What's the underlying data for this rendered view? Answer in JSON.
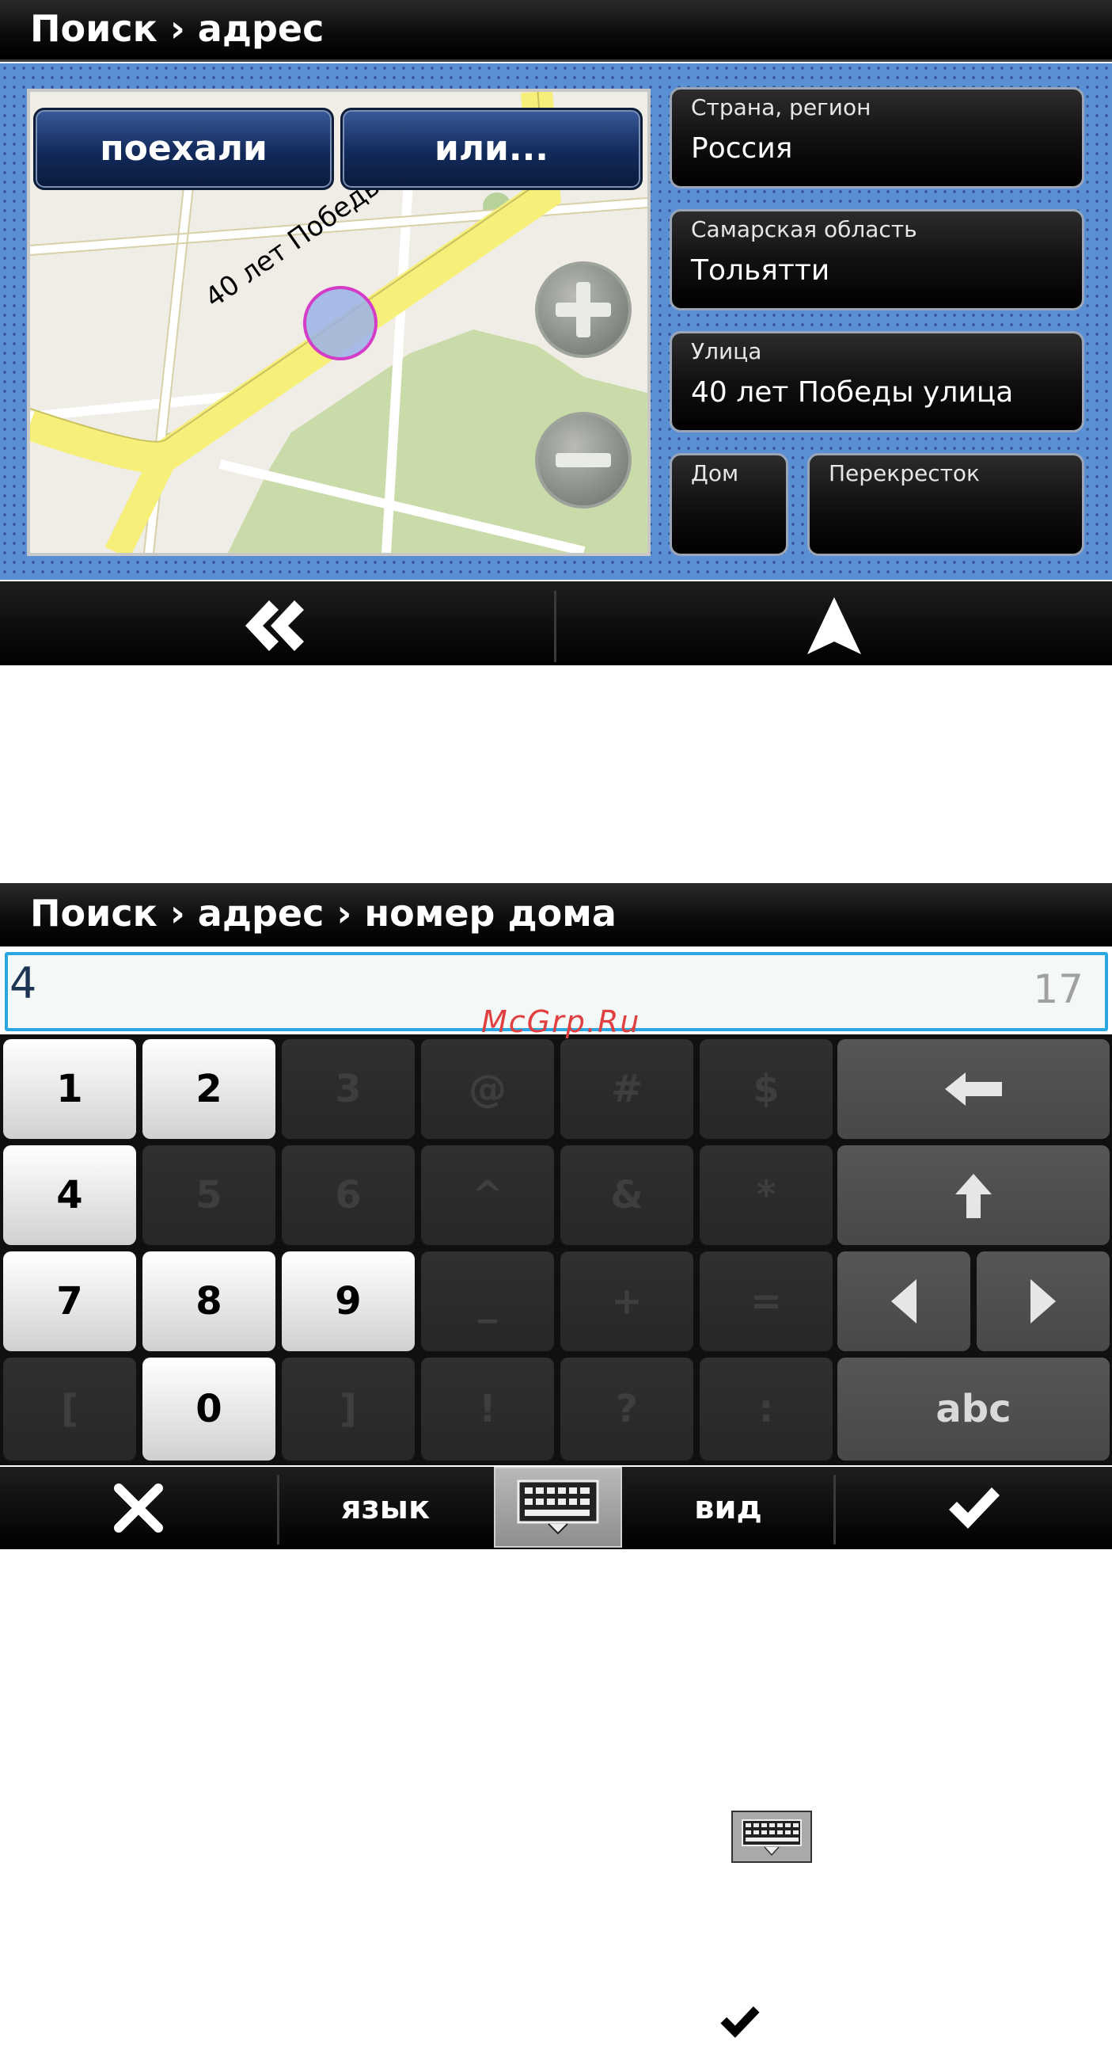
{
  "screen1": {
    "title": "Поиск › адрес",
    "map": {
      "go_button": "поехали",
      "or_button": "или...",
      "street_label": "40 лет Победы улица"
    },
    "fields": {
      "country": {
        "label": "Страна, регион",
        "value": "Россия"
      },
      "region": {
        "label": "Самарская область",
        "value": "Тольятти"
      },
      "street": {
        "label": "Улица",
        "value": "40 лет Победы улица"
      },
      "house": {
        "label": "Дом",
        "value": ""
      },
      "crossing": {
        "label": "Перекресток",
        "value": ""
      }
    },
    "bottom_icons": [
      "double-chevron-left-icon",
      "navigation-arrow-icon"
    ]
  },
  "screen2": {
    "title": "Поиск › адрес › номер дома",
    "input": {
      "value": "4",
      "counter": "17"
    },
    "watermark": "McGrp.Ru",
    "keys": {
      "row1": [
        "1",
        "2",
        "3",
        "@",
        "#",
        "$"
      ],
      "row2": [
        "4",
        "5",
        "6",
        "^",
        "&",
        "*"
      ],
      "row3": [
        "7",
        "8",
        "9",
        "_",
        "+",
        "="
      ],
      "row4": [
        "[",
        "0",
        "]",
        "!",
        "?",
        ":"
      ],
      "abc": "abc"
    },
    "toolbar": {
      "language": "язык",
      "view": "вид"
    }
  },
  "colors": {
    "accent_blue": "#5b8fd4",
    "input_border": "#2aa6e0"
  }
}
